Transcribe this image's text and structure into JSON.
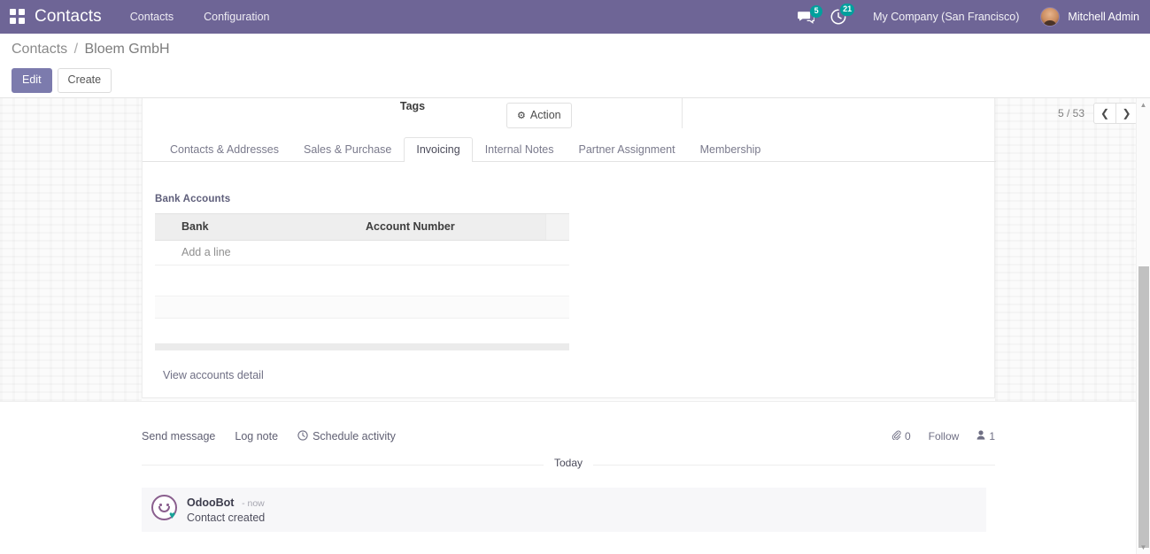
{
  "navbar": {
    "apps_icon": "apps-grid-icon",
    "brand": "Contacts",
    "menu_items": [
      {
        "label": "Contacts",
        "name": "menu-contacts"
      },
      {
        "label": "Configuration",
        "name": "menu-configuration"
      }
    ],
    "messages_icon": "messages-icon",
    "messages_count": "5",
    "activities_icon": "clock-activities-icon",
    "activities_count": "21",
    "company": "My Company (San Francisco)",
    "user": "Mitchell Admin",
    "accent_color": "#6e6596",
    "badge_color": "#00a09d"
  },
  "control_panel": {
    "breadcrumb_root": "Contacts",
    "breadcrumb_sep": "/",
    "breadcrumb_current": "Bloem GmbH",
    "edit_label": "Edit",
    "create_label": "Create",
    "action_label": "Action",
    "action_icon": "gear-icon",
    "pager_text": "5 / 53",
    "prev_icon": "chevron-left-icon",
    "next_icon": "chevron-right-icon",
    "primary_color": "#7c7bad"
  },
  "form": {
    "tags_label": "Tags",
    "tabs": [
      {
        "label": "Contacts & Addresses",
        "name": "tab-contacts-addresses",
        "active": false
      },
      {
        "label": "Sales & Purchase",
        "name": "tab-sales-purchase",
        "active": false
      },
      {
        "label": "Invoicing",
        "name": "tab-invoicing",
        "active": true
      },
      {
        "label": "Internal Notes",
        "name": "tab-internal-notes",
        "active": false
      },
      {
        "label": "Partner Assignment",
        "name": "tab-partner-assignment",
        "active": false
      },
      {
        "label": "Membership",
        "name": "tab-membership",
        "active": false
      }
    ],
    "invoicing": {
      "group_title": "Bank Accounts",
      "columns": [
        "Bank",
        "Account Number"
      ],
      "rows": [],
      "add_line_label": "Add a line",
      "view_detail_label": "View accounts detail"
    }
  },
  "chatter": {
    "send_message": "Send message",
    "log_note": "Log note",
    "schedule_activity": "Schedule activity",
    "schedule_icon": "clock-icon",
    "attachment_icon": "paperclip-icon",
    "attachment_count": "0",
    "follow_label": "Follow",
    "followers_icon": "user-icon",
    "followers_count": "1",
    "date_separator": "Today",
    "messages": [
      {
        "author": "OdooBot",
        "time": "- now",
        "body": "Contact created",
        "avatar": "odoobot-avatar"
      }
    ]
  },
  "scrollbar": {
    "up_icon": "caret-up-icon",
    "down_icon": "caret-down-icon"
  }
}
